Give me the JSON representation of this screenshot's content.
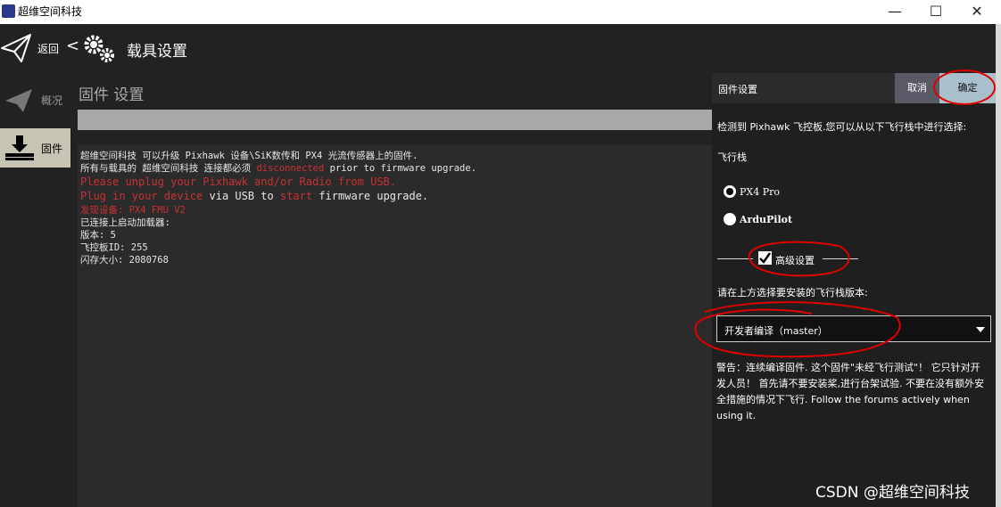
{
  "window": {
    "title": "超维空间科技",
    "minimize": "—",
    "maximize": "☐",
    "close": "✕"
  },
  "toolbar": {
    "back_label": "返回",
    "chevron": "<",
    "title": "载具设置"
  },
  "nav": {
    "items": [
      {
        "label": "概况",
        "active": false
      },
      {
        "label": "固件",
        "active": true
      }
    ]
  },
  "content": {
    "title": "固件 设置",
    "log": [
      {
        "text": "超维空间科技 可以升级 Pixhawk 设备\\SiK数传和 PX4 光流传感器上的固件.",
        "color": "normal"
      },
      {
        "text": "所有与载具的 超维空间科技 连接都必须 ",
        "colored": "disconnected",
        "tail": " prior to firmware upgrade."
      },
      {
        "text": "Please unplug your Pixhawk and/or Radio from USB.",
        "color": "red"
      },
      {
        "text": "Plug in your device",
        "mid": " via USB to ",
        "colored": "start",
        "tail": " firmware upgrade."
      },
      {
        "text": "发现设备: PX4 FMU V2",
        "color": "red"
      },
      {
        "text": "已连接上启动加载器:",
        "color": "normal"
      },
      {
        "text": "版本:  5",
        "color": "normal"
      },
      {
        "text": "飞控板ID: 255",
        "color": "normal"
      },
      {
        "text": "闪存大小:  2080768",
        "color": "normal"
      }
    ]
  },
  "panel": {
    "title": "固件设置",
    "cancel_label": "取消",
    "ok_label": "确定",
    "detected_text": "检测到 Pixhawk 飞控板.您可以从以下飞行栈中进行选择:",
    "stack_label": "飞行栈",
    "options": [
      {
        "label": "PX4 Pro",
        "selected": true
      },
      {
        "label": "ArduPilot",
        "selected": false
      }
    ],
    "advanced_label": "高级设置",
    "advanced_checked": true,
    "version_prompt": "请在上方选择要安装的飞行栈版本:",
    "version_selected": "开发者编译（master）",
    "warning": "警告：连续编译固件. 这个固件\"未经飞行测试\"！ 它只针对开发人员！ 首先请不要安装桨,进行台架试验. 不要在没有额外安全措施的情况下飞行. Follow the forums actively when using it."
  },
  "watermark": "CSDN @超维空间科技",
  "colors": {
    "accent": "#a9c0cc",
    "annotation": "#e00000",
    "error": "#c83232"
  }
}
